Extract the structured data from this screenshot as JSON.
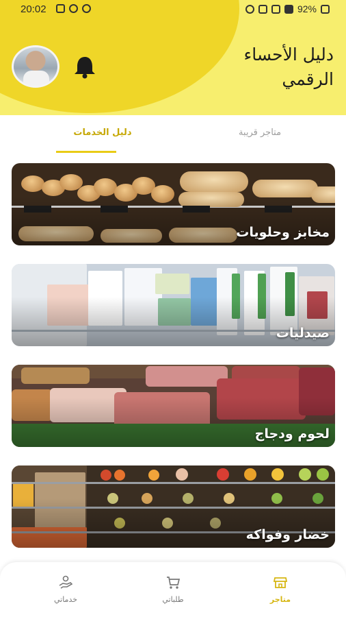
{
  "status_bar": {
    "time": "20:02",
    "battery": "92%"
  },
  "header": {
    "title": "دليل الأحساء الرقمي"
  },
  "tabs": [
    {
      "label": "دليل الخدمات",
      "active": true
    },
    {
      "label": "متاجر قريبة",
      "active": false
    }
  ],
  "categories": [
    {
      "label": "مخابز وحلويات"
    },
    {
      "label": "صيدليات"
    },
    {
      "label": "لحوم ودجاج"
    },
    {
      "label": "خضار وفواكه"
    }
  ],
  "bottom_nav": {
    "services": "خدماتي",
    "orders": "طلباتي",
    "stores": "متاجر"
  },
  "colors": {
    "accent": "#efd628",
    "header_light": "#f7ee6e",
    "active_text": "#d6b612"
  }
}
